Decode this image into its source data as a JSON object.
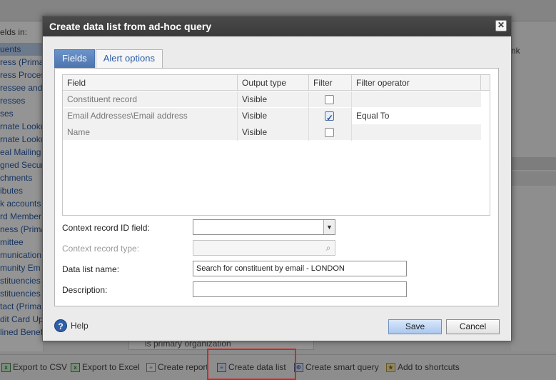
{
  "background": {
    "left_header": "elds in:",
    "left_items": [
      "uents",
      "ress (Prima",
      "ress Proces",
      "ressee and",
      "resses",
      "ses",
      "rnate Looku",
      "rnate Looku",
      "eal Mailing",
      "gned Secur",
      "chments",
      "ibutes",
      "k accounts",
      "rd Member",
      "ness (Prima",
      "mittee",
      "munication",
      "munity Em",
      "stituencies",
      "stituencies",
      "tact (Prima",
      "dit Card Up",
      "lined Benef"
    ],
    "right_text": "nk",
    "behind_row_text": "is primary organization",
    "bottom_bar": {
      "export_csv": "Export to CSV",
      "export_excel": "Export to Excel",
      "create_report": "Create report",
      "create_data_list": "Create data list",
      "create_smart_query": "Create smart query",
      "add_to_shortcuts": "Add to shortcuts"
    },
    "highlight_color": "#e02020"
  },
  "dialog": {
    "title": "Create data list from ad-hoc query",
    "close_glyph": "✕",
    "tabs": [
      {
        "label": "Fields",
        "active": true
      },
      {
        "label": "Alert options",
        "active": false
      }
    ],
    "grid": {
      "columns": [
        "Field",
        "Output type",
        "Filter",
        "Filter operator"
      ],
      "rows": [
        {
          "field": "Constituent record",
          "output_type": "Visible",
          "filter": false,
          "filter_operator": ""
        },
        {
          "field": "Email Addresses\\Email address",
          "output_type": "Visible",
          "filter": true,
          "filter_operator": "Equal To"
        },
        {
          "field": "Name",
          "output_type": "Visible",
          "filter": false,
          "filter_operator": ""
        }
      ]
    },
    "form": {
      "context_record_id_label": "Context record ID field:",
      "context_record_id_value": "",
      "context_record_type_label": "Context record type:",
      "context_record_type_value": "",
      "data_list_name_label": "Data list name:",
      "data_list_name_value": "Search for constituent by email - LONDON",
      "description_label": "Description:",
      "description_value": ""
    },
    "footer": {
      "help_label": "Help",
      "save_label": "Save",
      "cancel_label": "Cancel"
    }
  }
}
